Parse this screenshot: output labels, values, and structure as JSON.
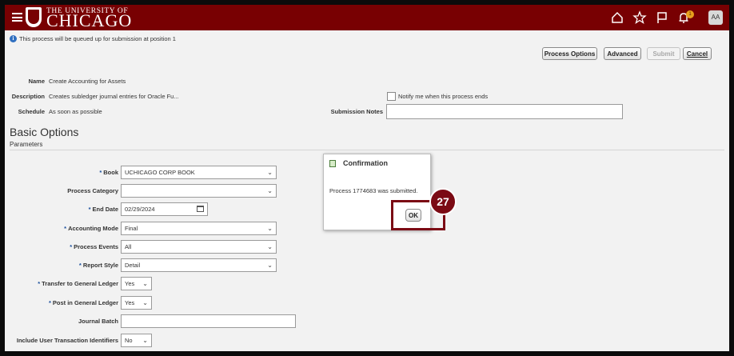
{
  "header": {
    "logo_small": "THE UNIVERSITY OF",
    "logo_big": "CHICAGO",
    "notification_count": "1",
    "avatar_initials": "AA",
    "brand_color": "#780002"
  },
  "info_message": "This process will be queued up for submission at position 1",
  "toolbar": {
    "process_options_label": "Process Options",
    "advanced_label": "Advanced",
    "submit_label": "Submit",
    "cancel_label": "Cancel"
  },
  "summary": {
    "name_label": "Name",
    "name_value": "Create Accounting for Assets",
    "description_label": "Description",
    "description_value": "Creates subledger journal entries for Oracle Fu...",
    "schedule_label": "Schedule",
    "schedule_value": "As soon as possible",
    "notify_label": "Notify me when this process ends",
    "submission_notes_label": "Submission Notes",
    "submission_notes_value": ""
  },
  "basic_options": {
    "title": "Basic Options",
    "subtitle": "Parameters"
  },
  "params": {
    "book_label": "Book",
    "book_value": "UCHICAGO CORP BOOK",
    "process_category_label": "Process Category",
    "process_category_value": "",
    "end_date_label": "End Date",
    "end_date_value": "02/29/2024",
    "accounting_mode_label": "Accounting Mode",
    "accounting_mode_value": "Final",
    "process_events_label": "Process Events",
    "process_events_value": "All",
    "report_style_label": "Report Style",
    "report_style_value": "Detail",
    "transfer_gl_label": "Transfer to General Ledger",
    "transfer_gl_value": "Yes",
    "post_gl_label": "Post in General Ledger",
    "post_gl_value": "Yes",
    "journal_batch_label": "Journal Batch",
    "journal_batch_value": "",
    "user_txn_label": "Include User Transaction Identifiers",
    "user_txn_value": "No",
    "required_marker": "*"
  },
  "dialog": {
    "title": "Confirmation",
    "message": "Process 1774683 was submitted.",
    "ok_label": "OK"
  },
  "step_marker": "27",
  "step_color": "#7b0a14"
}
